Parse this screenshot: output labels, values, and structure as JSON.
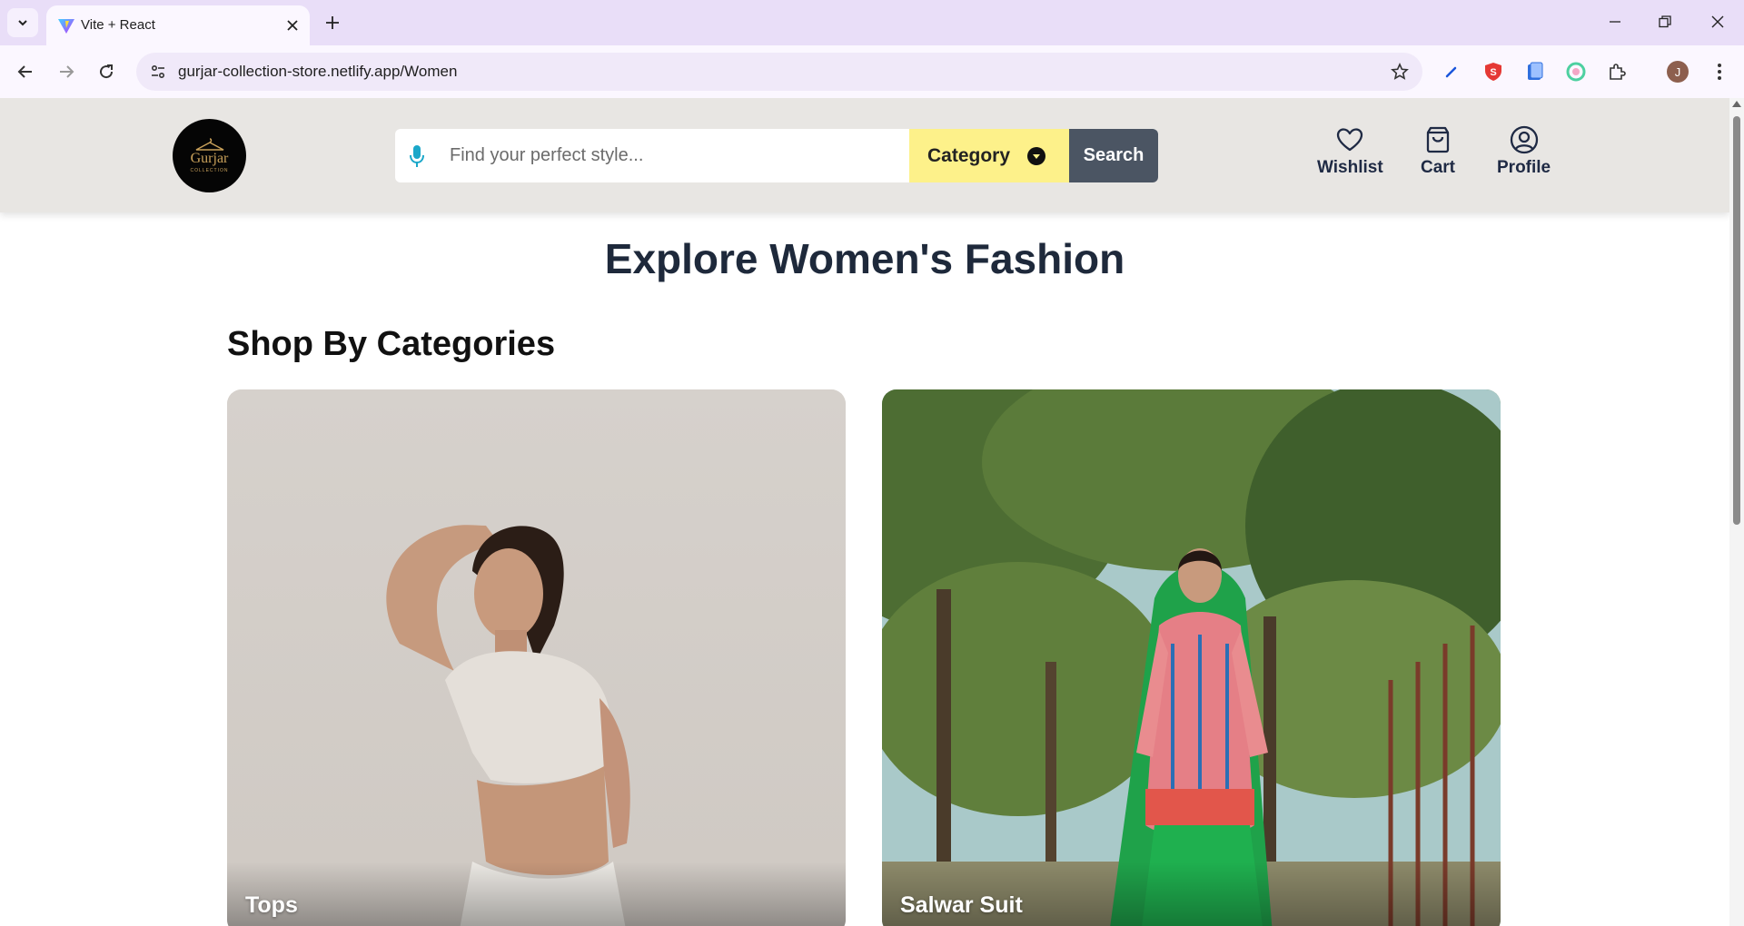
{
  "browser": {
    "tab_title": "Vite + React",
    "url": "gurjar-collection-store.netlify.app/Women",
    "profile_initial": "J"
  },
  "header": {
    "logo_name": "Gurjar",
    "logo_sub": "COLLECTION",
    "search_placeholder": "Find your perfect style...",
    "category_label": "Category",
    "search_label": "Search",
    "actions": {
      "wishlist": "Wishlist",
      "cart": "Cart",
      "profile": "Profile"
    }
  },
  "main": {
    "title": "Explore Women's Fashion",
    "section_title": "Shop By Categories",
    "categories": [
      {
        "label": "Tops"
      },
      {
        "label": "Salwar Suit"
      }
    ]
  },
  "colors": {
    "header_bg": "#e8e6e3",
    "category_bg": "#fdf18a",
    "search_btn_bg": "#4b5563",
    "title_color": "#1e293b"
  }
}
